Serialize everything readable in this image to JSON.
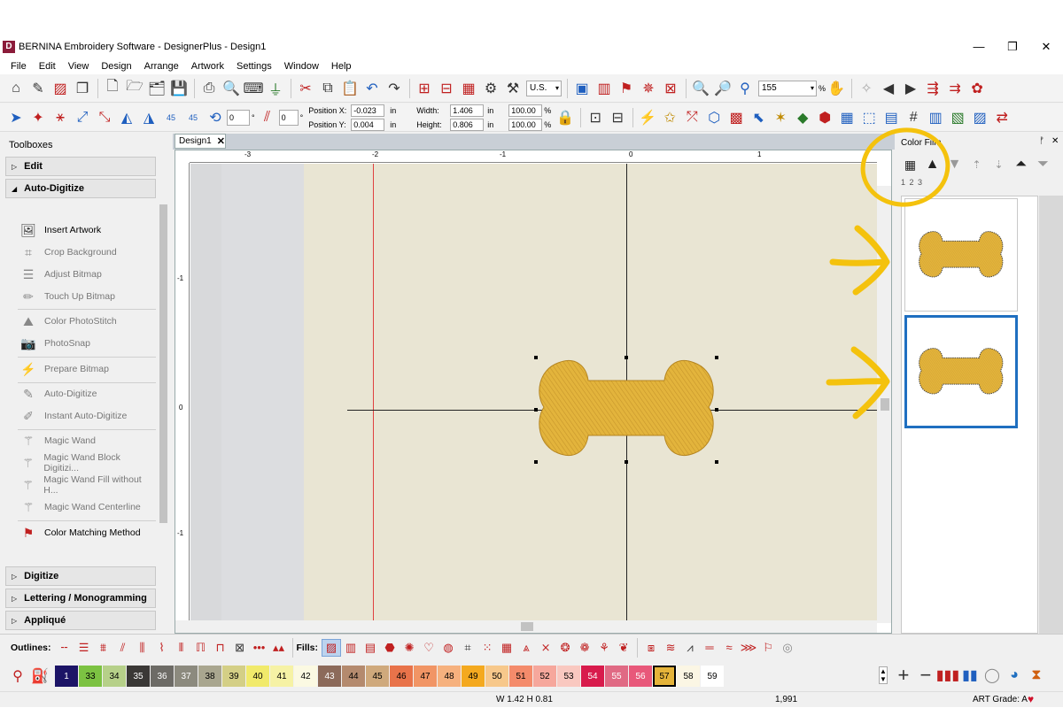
{
  "window": {
    "app_icon": "D",
    "title": "BERNINA Embroidery Software - DesignerPlus - Design1",
    "controls": [
      "—",
      "❐",
      "✕"
    ]
  },
  "menu": [
    "File",
    "Edit",
    "View",
    "Design",
    "Arrange",
    "Artwork",
    "Settings",
    "Window",
    "Help"
  ],
  "toolbar1": {
    "unit": "U.S.",
    "zoom": "155",
    "zoom_unit": "%"
  },
  "toolbar2": {
    "angle1": "0",
    "angle2": "0",
    "rotate_labels": [
      "45",
      "45"
    ],
    "position_x_label": "Position X:",
    "position_x": "-0.023",
    "position_y_label": "Position Y:",
    "position_y": "0.004",
    "unit": "in",
    "width_label": "Width:",
    "width": "1.406",
    "height_label": "Height:",
    "height": "0.806",
    "scale_w": "100.00",
    "scale_h": "100.00",
    "percent": "%"
  },
  "toolboxes": {
    "title": "Toolboxes",
    "sections": [
      "Edit",
      "Auto-Digitize",
      "Digitize",
      "Lettering / Monogramming",
      "Appliqué"
    ],
    "tools": [
      {
        "label": "Insert Artwork",
        "enabled": true
      },
      {
        "label": "Crop Background",
        "enabled": false
      },
      {
        "label": "Adjust Bitmap",
        "enabled": false
      },
      {
        "label": "Touch Up Bitmap",
        "enabled": false
      },
      {
        "label": "Color PhotoStitch",
        "enabled": false
      },
      {
        "label": "PhotoSnap",
        "enabled": false
      },
      {
        "label": "Prepare Bitmap",
        "enabled": false
      },
      {
        "label": "Auto-Digitize",
        "enabled": false
      },
      {
        "label": "Instant Auto-Digitize",
        "enabled": false
      },
      {
        "label": "Magic Wand",
        "enabled": false
      },
      {
        "label": "Magic Wand Block Digitizi...",
        "enabled": false
      },
      {
        "label": "Magic Wand Fill without H...",
        "enabled": false
      },
      {
        "label": "Magic Wand Centerline",
        "enabled": false
      },
      {
        "label": "Color Matching Method",
        "enabled": true
      }
    ]
  },
  "document": {
    "tab": "Design1",
    "tab_close": "✕",
    "ruler_h": [
      "-3",
      "-2",
      "-1",
      "0",
      "1"
    ],
    "ruler_v": [
      "-1",
      "0",
      "-1"
    ]
  },
  "color_film": {
    "title": "Color Film",
    "pin": "📌",
    "close": "✕",
    "seq_label": "1 2 3"
  },
  "outlines": {
    "label": "Outlines:",
    "fills_label": "Fills:"
  },
  "palette": [
    {
      "n": "1",
      "color": "#1c1466",
      "text": "#ffffff"
    },
    {
      "n": "33",
      "color": "#7cc242",
      "text": "#000000"
    },
    {
      "n": "34",
      "color": "#b6d089",
      "text": "#000000"
    },
    {
      "n": "35",
      "color": "#3a3836",
      "text": "#ffffff"
    },
    {
      "n": "36",
      "color": "#6d6b66",
      "text": "#ffffff"
    },
    {
      "n": "37",
      "color": "#8c8a7e",
      "text": "#ffffff"
    },
    {
      "n": "38",
      "color": "#a9a68f",
      "text": "#000000"
    },
    {
      "n": "39",
      "color": "#d4cf86",
      "text": "#000000"
    },
    {
      "n": "40",
      "color": "#f1ea6b",
      "text": "#000000"
    },
    {
      "n": "41",
      "color": "#f6f2a5",
      "text": "#000000"
    },
    {
      "n": "42",
      "color": "#fbf9e2",
      "text": "#000000"
    },
    {
      "n": "43",
      "color": "#8c6a5a",
      "text": "#ffffff"
    },
    {
      "n": "44",
      "color": "#b48a6e",
      "text": "#000000"
    },
    {
      "n": "45",
      "color": "#cfa97c",
      "text": "#000000"
    },
    {
      "n": "46",
      "color": "#e8734a",
      "text": "#000000"
    },
    {
      "n": "47",
      "color": "#f19565",
      "text": "#000000"
    },
    {
      "n": "48",
      "color": "#f6b17e",
      "text": "#000000"
    },
    {
      "n": "49",
      "color": "#f4a91f",
      "text": "#000000"
    },
    {
      "n": "50",
      "color": "#f7c88b",
      "text": "#000000"
    },
    {
      "n": "51",
      "color": "#f48b6b",
      "text": "#000000"
    },
    {
      "n": "52",
      "color": "#f6a79c",
      "text": "#000000"
    },
    {
      "n": "53",
      "color": "#f9c8c0",
      "text": "#000000"
    },
    {
      "n": "54",
      "color": "#d81b4c",
      "text": "#ffffff"
    },
    {
      "n": "55",
      "color": "#e06a84",
      "text": "#ffffff"
    },
    {
      "n": "56",
      "color": "#e8587a",
      "text": "#ffffff"
    },
    {
      "n": "57",
      "color": "#e5b43a",
      "text": "#000000"
    },
    {
      "n": "58",
      "color": "#fbf6e4",
      "text": "#000000"
    },
    {
      "n": "59",
      "color": "#ffffff",
      "text": "#000000"
    }
  ],
  "current_color": "57",
  "status": {
    "size": "W 1.42  H 0.81",
    "stitches": "1,991",
    "art_grade": "ART Grade: A",
    "heart": "♥"
  },
  "colors": {
    "accent": "#1f6fc0",
    "bone_fill": "#e5b43a",
    "annotation": "#f4c20d"
  }
}
